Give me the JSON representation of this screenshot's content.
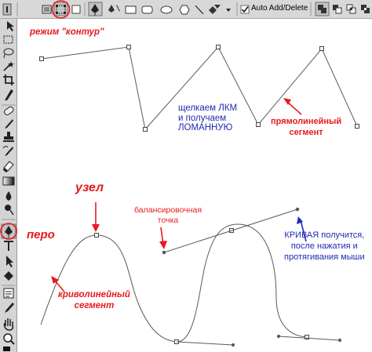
{
  "options_bar": {
    "auto_add_delete_label": "Auto Add/Delete",
    "auto_add_delete_checked": true,
    "icons": [
      "shape-layers-icon",
      "paths-icon",
      "fill-pixels-icon",
      "pen-tool-icon",
      "freeform-pen-icon",
      "rectangle-icon",
      "rounded-rectangle-icon",
      "ellipse-icon",
      "polygon-icon",
      "line-icon",
      "custom-shape-icon",
      "dropdown-arrow-icon",
      "combine-icon",
      "subtract-icon",
      "intersect-icon",
      "exclude-icon"
    ]
  },
  "toolbar": {
    "tools": [
      "move-tool-icon",
      "marquee-tool-icon",
      "lasso-tool-icon",
      "magic-wand-icon",
      "crop-tool-icon",
      "slice-tool-icon",
      "healing-brush-icon",
      "brush-tool-icon",
      "clone-stamp-icon",
      "history-brush-icon",
      "eraser-tool-icon",
      "gradient-tool-icon",
      "blur-tool-icon",
      "dodge-tool-icon",
      "pen-tool-icon",
      "type-tool-icon",
      "path-selection-icon",
      "custom-shape-tool-icon",
      "notes-tool-icon",
      "eyedropper-tool-icon",
      "hand-tool-icon",
      "zoom-tool-icon"
    ],
    "active_tool": "pen-tool-icon"
  },
  "annotations": {
    "mode_label": "режим \"контур\"",
    "click_lkm": [
      "щелкаем ЛКМ",
      "и получаем",
      "ЛОМАННУЮ"
    ],
    "straight_segment": [
      "прямолинейный",
      "сегмент"
    ],
    "node": "узел",
    "balance_point": [
      "балансировочная",
      "точка"
    ],
    "pen": "перо",
    "curve_explain": [
      "КРИВАЯ получится,",
      "после нажатия и",
      "протягивания мыши"
    ],
    "curved_segment": [
      "криволинейный",
      "сегмент"
    ]
  },
  "colors": {
    "annotation_red": "#e8191d",
    "annotation_blue": "#1f2bb0",
    "path": "#5a5a5a"
  }
}
